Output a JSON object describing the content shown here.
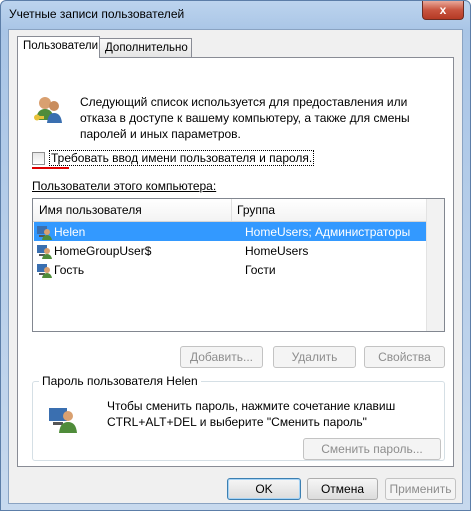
{
  "window": {
    "title": "Учетные записи пользователей",
    "close_glyph": "x"
  },
  "tabs": [
    {
      "label": "Пользователи",
      "active": true
    },
    {
      "label": "Дополнительно",
      "active": false
    }
  ],
  "info_text": "Следующий список используется для предоставления или отказа в доступе к вашему компьютеру, а также для смены паролей и иных параметров.",
  "require_login": {
    "label": "Требовать ввод имени пользователя и пароля.",
    "checked": false
  },
  "users_section_label": "Пользователи этого компьютера:",
  "table": {
    "columns": [
      "Имя пользователя",
      "Группа"
    ],
    "rows": [
      {
        "name": "Helen",
        "group": "HomeUsers; Администраторы",
        "selected": true
      },
      {
        "name": "HomeGroupUser$",
        "group": "HomeUsers",
        "selected": false
      },
      {
        "name": "Гость",
        "group": "Гости",
        "selected": false
      }
    ]
  },
  "list_buttons": {
    "add": "Добавить...",
    "remove": "Удалить",
    "properties": "Свойства"
  },
  "password_group": {
    "title": "Пароль пользователя Helen",
    "text": "Чтобы сменить пароль, нажмите сочетание клавиш CTRL+ALT+DEL и выберите \"Сменить пароль\"",
    "button": "Сменить пароль..."
  },
  "dialog_buttons": {
    "ok": "OK",
    "cancel": "Отмена",
    "apply": "Применить"
  },
  "colors": {
    "selection": "#3399ff",
    "underline": "#dd0000"
  }
}
